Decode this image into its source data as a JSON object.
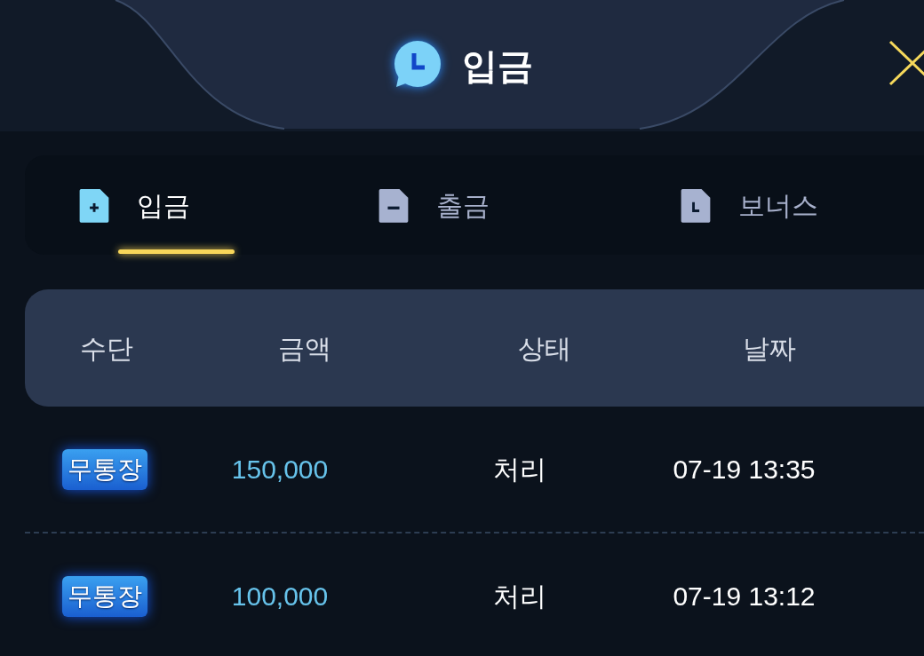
{
  "header": {
    "title": "입금"
  },
  "tabs": [
    {
      "label": "입금",
      "kind": "plus",
      "selected": true
    },
    {
      "label": "출금",
      "kind": "minus",
      "selected": false
    },
    {
      "label": "보너스",
      "kind": "clock",
      "selected": false
    }
  ],
  "table": {
    "columns": [
      "수단",
      "금액",
      "상태",
      "날짜"
    ],
    "rows": [
      {
        "method": "무통장",
        "amount": "150,000",
        "status": "처리",
        "date": "07-19 13:35"
      },
      {
        "method": "무통장",
        "amount": "100,000",
        "status": "처리",
        "date": "07-19 13:12"
      }
    ]
  }
}
